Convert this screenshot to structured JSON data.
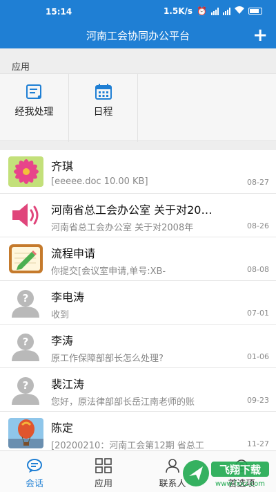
{
  "status": {
    "time": "15:14",
    "speed": "1.5K/s",
    "battery_icon": "battery-icon"
  },
  "header": {
    "title": "河南工会协同办公平台",
    "add_icon": "+"
  },
  "apps": {
    "section_label": "应用",
    "items": [
      {
        "label": "经我处理",
        "icon": "task-list-icon"
      },
      {
        "label": "日程",
        "icon": "calendar-icon"
      }
    ]
  },
  "conversations": [
    {
      "name": "齐琪",
      "preview": "[eeeee.doc 10.00 KB]",
      "date": "08-27",
      "avatar": "flower-photo"
    },
    {
      "name": "河南省总工会办公室 关于对20…",
      "preview": "河南省总工会办公室 关于对2008年",
      "date": "08-26",
      "avatar": "speaker-icon"
    },
    {
      "name": "流程申请",
      "preview": "你提交[会议室申请,单号:XB-",
      "date": "08-08",
      "avatar": "notepad-icon"
    },
    {
      "name": "李电涛",
      "preview": "收到",
      "date": "07-01",
      "avatar": "default-user-icon"
    },
    {
      "name": "李涛",
      "preview": "原工作保障部部长怎么处理?",
      "date": "01-06",
      "avatar": "default-user-icon"
    },
    {
      "name": "裴江涛",
      "preview": "您好，原法律部部长岳江南老师的账",
      "date": "09-23",
      "avatar": "default-user-icon"
    },
    {
      "name": "陈定",
      "preview": "[20200210：河南工会第12期 省总工",
      "date": "11-27",
      "avatar": "balloon-photo"
    }
  ],
  "tabs": [
    {
      "label": "会话",
      "active": true
    },
    {
      "label": "应用",
      "active": false
    },
    {
      "label": "联系人",
      "active": false
    },
    {
      "label": "首选项",
      "active": false
    }
  ],
  "watermark": {
    "text": "飞翔下载",
    "url": "www.fxxz.com"
  },
  "colors": {
    "brand": "#1f7fd4",
    "background": "#eeeeee"
  }
}
